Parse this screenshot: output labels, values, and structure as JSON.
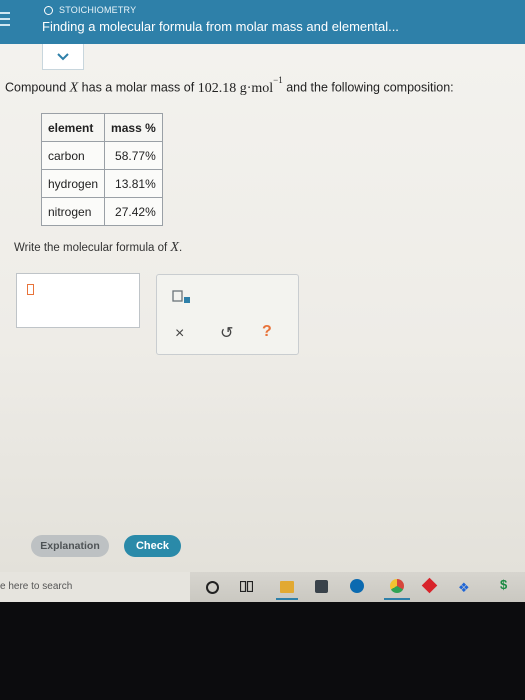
{
  "header": {
    "topic": "STOICHIOMETRY",
    "title": "Finding a molecular formula from molar mass and elemental..."
  },
  "question": {
    "prefix": "Compound ",
    "compound_symbol": "X",
    "middle": " has a molar mass of ",
    "molar_mass": "102.18",
    "unit": "g·mol",
    "unit_exponent": "−1",
    "suffix": " and the following composition:"
  },
  "composition_table": {
    "headers": [
      "element",
      "mass %"
    ],
    "rows": [
      [
        "carbon",
        "58.77%"
      ],
      [
        "hydrogen",
        "13.81%"
      ],
      [
        "nitrogen",
        "27.42%"
      ]
    ]
  },
  "prompt": {
    "text": "Write the molecular formula of ",
    "symbol": "X",
    "end": "."
  },
  "answer": {
    "value": ""
  },
  "tools": {
    "clear_icon": "close-icon",
    "undo_icon": "undo-icon",
    "help_icon": "help-icon",
    "subscript_icon": "subscript-icon",
    "clear_glyph": "×",
    "undo_glyph": "↺",
    "help_glyph": "?"
  },
  "buttons": {
    "explanation": "Explanation",
    "check": "Check"
  },
  "taskbar": {
    "search_placeholder": "e here to search"
  },
  "colors": {
    "header": "#2e80a9",
    "check_button": "#2a8aa9",
    "cursor": "#e8733a"
  }
}
